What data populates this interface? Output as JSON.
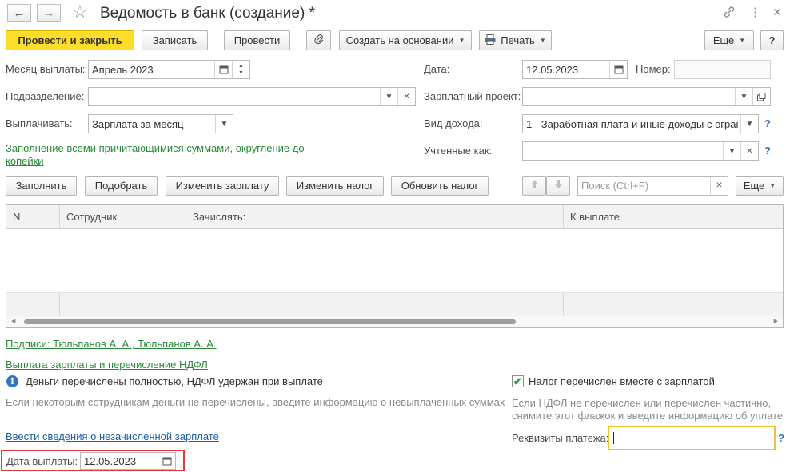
{
  "window": {
    "title": "Ведомость в банк (создание) *",
    "back_icon": "←",
    "forward_icon": "→",
    "star_icon": "☆",
    "link_icon": "🔗",
    "more_icon": "⋮",
    "close_icon": "✕"
  },
  "toolbar": {
    "post_close": "Провести и закрыть",
    "save": "Записать",
    "post": "Провести",
    "attach_icon": "📎",
    "create_based": "Создать на основании",
    "print": "Печать",
    "more": "Еще",
    "help": "?"
  },
  "form": {
    "month_label": "Месяц выплаты:",
    "month_value": "Апрель 2023",
    "division_label": "Подразделение:",
    "division_value": "",
    "pay_label": "Выплачивать:",
    "pay_value": "Зарплата за месяц",
    "fill_link": "Заполнение всеми причитающимися суммами, округление до копейки",
    "fill_link_line1": "Заполнение всеми причитающимися суммами, округление до",
    "fill_link_line2": "копейки",
    "date_label": "Дата:",
    "date_value": "12.05.2023",
    "number_label": "Номер:",
    "number_value": "",
    "salary_project_label": "Зарплатный проект:",
    "salary_project_value": "",
    "income_type_label": "Вид дохода:",
    "income_type_value": "1 - Заработная плата и иные доходы с огран",
    "accounted_label": "Учтенные как:",
    "accounted_value": ""
  },
  "table_toolbar": {
    "fill": "Заполнить",
    "select": "Подобрать",
    "change_salary": "Изменить зарплату",
    "change_tax": "Изменить налог",
    "update_tax": "Обновить налог",
    "search_placeholder": "Поиск (Ctrl+F)",
    "more": "Еще"
  },
  "table": {
    "columns": [
      "N",
      "Сотрудник",
      "Зачислять:",
      "К выплате"
    ],
    "rows": []
  },
  "bottom": {
    "signatures_link": "Подписи: Тюльпанов А. А., Тюльпанов А. А.",
    "payment_link": "Выплата зарплаты и перечисление НДФЛ",
    "info_icon": "i",
    "info_text": "Деньги перечислены  полностью, НДФЛ удержан при выплате",
    "hint_left": "Если некоторым сотрудникам деньги не перечислены, введите информацию о невыплаченных суммах",
    "tax_checkbox_label": "Налог перечислен вместе с зарплатой",
    "tax_checked": true,
    "hint_right_1": "Если НДФЛ не перечислен или перечислен частично,",
    "hint_right_2": "снимите этот флажок и введите информацию об уплате",
    "unaccrued_link": "Ввести сведения о незачисленной зарплате",
    "requisites_label": "Реквизиты платежа:",
    "requisites_value": "",
    "pay_date_label": "Дата выплаты:",
    "pay_date_value": "12.05.2023"
  },
  "colors": {
    "primary_button": "#fddc2a",
    "link_green": "#2a8a3a",
    "link_blue": "#1f5fa8",
    "highlight_red": "#e53935",
    "focus_yellow": "#f2c12e"
  }
}
